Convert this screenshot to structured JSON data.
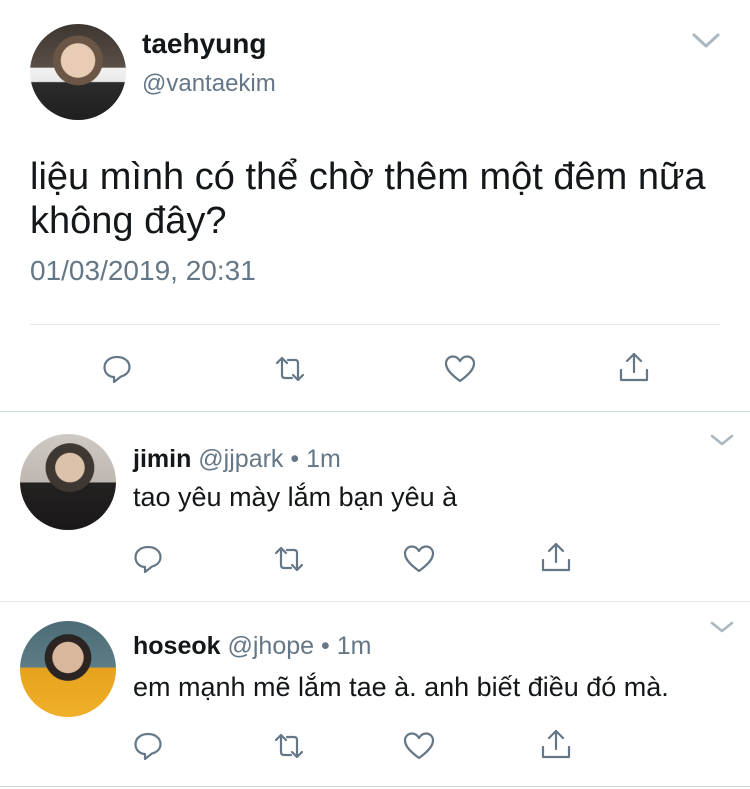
{
  "main_tweet": {
    "display_name": "taehyung",
    "handle": "@vantaekim",
    "text": "liệu mình có thể chờ thêm một đêm nữa không đây?",
    "timestamp": "01/03/2019, 20:31"
  },
  "replies": [
    {
      "display_name": "jimin",
      "handle": "@jjpark",
      "separator": "•",
      "age": "1m",
      "text": "tao yêu mày lắm bạn yêu à"
    },
    {
      "display_name": "hoseok",
      "handle": "@jhope",
      "separator": "•",
      "age": "1m",
      "text": "em mạnh mẽ lắm tae à. anh biết điều đó mà."
    }
  ],
  "icons": {
    "reply": "reply-icon",
    "retweet": "retweet-icon",
    "like": "heart-icon",
    "share": "share-icon",
    "more": "chevron-down-icon"
  },
  "colors": {
    "text": "#14171a",
    "secondary": "#657786",
    "divider": "#e1e8ed"
  }
}
